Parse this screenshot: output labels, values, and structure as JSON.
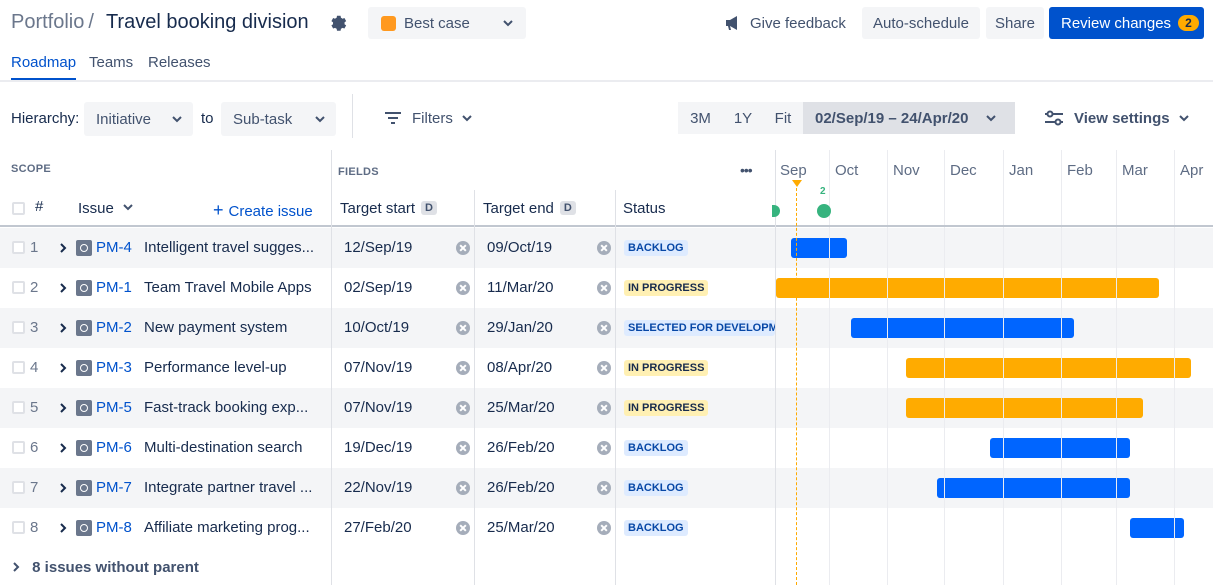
{
  "header": {
    "breadcrumb": "Portfolio",
    "separator": "/",
    "title": "Travel booking division",
    "scenario_label": "Best case",
    "scenario_color": "#ff991f",
    "feedback_label": "Give feedback",
    "autoschedule_label": "Auto-schedule",
    "share_label": "Share",
    "review_label": "Review changes",
    "review_count": "2"
  },
  "tabs": [
    {
      "label": "Roadmap",
      "active": true
    },
    {
      "label": "Teams",
      "active": false
    },
    {
      "label": "Releases",
      "active": false
    }
  ],
  "toolbar": {
    "hierarchy_label": "Hierarchy:",
    "hierarchy_from": "Initiative",
    "to_label": "to",
    "hierarchy_to": "Sub-task",
    "filters_label": "Filters",
    "zoom_3m": "3M",
    "zoom_1y": "1Y",
    "zoom_fit": "Fit",
    "date_range": "02/Sep/19 – 24/Apr/20",
    "view_settings_label": "View settings"
  },
  "grid": {
    "scope_caption": "SCOPE",
    "fields_caption": "FIELDS",
    "more_label": "•••",
    "col_num": "#",
    "col_issue": "Issue",
    "create_issue_label": "Create issue",
    "col_target_start": "Target start",
    "col_target_end": "Target end",
    "date_badge": "D",
    "col_status": "Status",
    "months": [
      "Sep",
      "Oct",
      "Nov",
      "Dec",
      "Jan",
      "Feb",
      "Mar",
      "Apr"
    ],
    "release_count": "2",
    "footer_label": "8 issues without parent"
  },
  "issues": [
    {
      "num": "1",
      "key": "PM-4",
      "summary": "Intelligent travel sugges...",
      "start": "12/Sep/19",
      "end": "09/Oct/19",
      "status": "BACKLOG",
      "status_kind": "backlog",
      "bar_color": "blue"
    },
    {
      "num": "2",
      "key": "PM-1",
      "summary": "Team Travel Mobile Apps",
      "start": "02/Sep/19",
      "end": "11/Mar/20",
      "status": "IN PROGRESS",
      "status_kind": "progress",
      "bar_color": "orange"
    },
    {
      "num": "3",
      "key": "PM-2",
      "summary": "New payment system",
      "start": "10/Oct/19",
      "end": "29/Jan/20",
      "status": "SELECTED FOR DEVELOPM",
      "status_kind": "backlog",
      "bar_color": "blue"
    },
    {
      "num": "4",
      "key": "PM-3",
      "summary": "Performance level-up",
      "start": "07/Nov/19",
      "end": "08/Apr/20",
      "status": "IN PROGRESS",
      "status_kind": "progress",
      "bar_color": "orange"
    },
    {
      "num": "5",
      "key": "PM-5",
      "summary": "Fast-track booking exp...",
      "start": "07/Nov/19",
      "end": "25/Mar/20",
      "status": "IN PROGRESS",
      "status_kind": "progress",
      "bar_color": "orange"
    },
    {
      "num": "6",
      "key": "PM-6",
      "summary": "Multi-destination search",
      "start": "19/Dec/19",
      "end": "26/Feb/20",
      "status": "BACKLOG",
      "status_kind": "backlog",
      "bar_color": "blue"
    },
    {
      "num": "7",
      "key": "PM-7",
      "summary": "Integrate partner travel ...",
      "start": "22/Nov/19",
      "end": "26/Feb/20",
      "status": "BACKLOG",
      "status_kind": "backlog",
      "bar_color": "blue"
    },
    {
      "num": "8",
      "key": "PM-8",
      "summary": "Affiliate marketing prog...",
      "start": "27/Feb/20",
      "end": "25/Mar/20",
      "status": "BACKLOG",
      "status_kind": "backlog",
      "bar_color": "blue"
    }
  ],
  "timeline": {
    "bar_fractions": [
      [
        0.037,
        0.171
      ],
      [
        0.0,
        0.922
      ],
      [
        0.18,
        0.718
      ],
      [
        0.314,
        1.0
      ],
      [
        0.314,
        0.884
      ],
      [
        0.515,
        0.852
      ],
      [
        0.387,
        0.852
      ],
      [
        0.852,
        0.984
      ]
    ]
  },
  "colors": {
    "accent": "#0052cc",
    "bar_blue": "#0065ff",
    "bar_orange": "#ffab00",
    "release_green": "#36b37e",
    "today_marker": "#ffab00"
  }
}
